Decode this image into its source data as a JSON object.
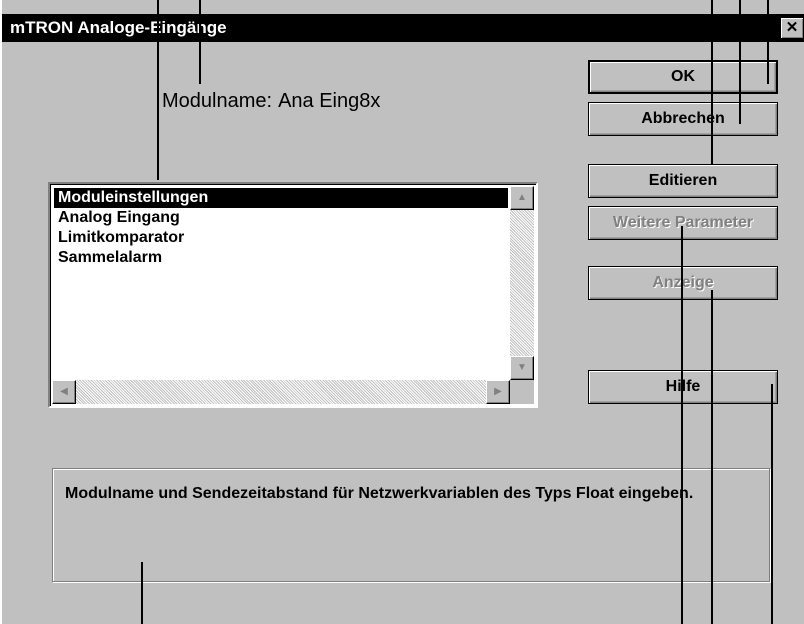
{
  "window": {
    "title": "mTRON Analoge-Eingänge",
    "close_label": "✕"
  },
  "module": {
    "label": "Modulname:",
    "name": "Ana Eing8x"
  },
  "list": {
    "items": [
      {
        "label": "Moduleinstellungen",
        "selected": true
      },
      {
        "label": "Analog Eingang",
        "selected": false
      },
      {
        "label": "Limitkomparator",
        "selected": false
      },
      {
        "label": "Sammelalarm",
        "selected": false
      }
    ]
  },
  "buttons": {
    "ok": "OK",
    "cancel": "Abbrechen",
    "edit": "Editieren",
    "more_params": "Weitere Parameter",
    "display": "Anzeige",
    "help": "Hilfe"
  },
  "description": "Modulname und Sendezeitabstand für Netzwerkvariablen des Typs Float eingeben.",
  "scroll_icons": {
    "up": "scroll-up-arrow-icon",
    "down": "scroll-down-arrow-icon",
    "left": "scroll-left-arrow-icon",
    "right": "scroll-right-arrow-icon"
  },
  "colors": {
    "dialog_bg": "#c0c0c0",
    "titlebar_bg": "#000000",
    "disabled_text": "#808080"
  }
}
